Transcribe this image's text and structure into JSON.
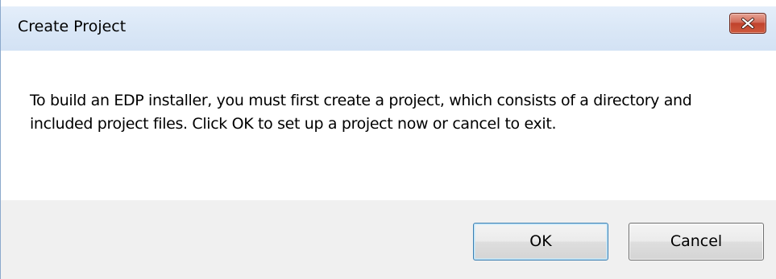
{
  "window": {
    "title": "Create Project",
    "close_icon": "close-icon"
  },
  "message": {
    "text": "To build an EDP installer, you must first create a project, which consists of a directory and included project files.  Click OK to set up a project now or cancel to exit."
  },
  "buttons": {
    "ok_label": "OK",
    "cancel_label": "Cancel"
  },
  "colors": {
    "title_bar": "#dbe8f7",
    "close_button": "#c7503a",
    "footer": "#f0f0f0",
    "default_button_border": "#3c7fb1"
  }
}
